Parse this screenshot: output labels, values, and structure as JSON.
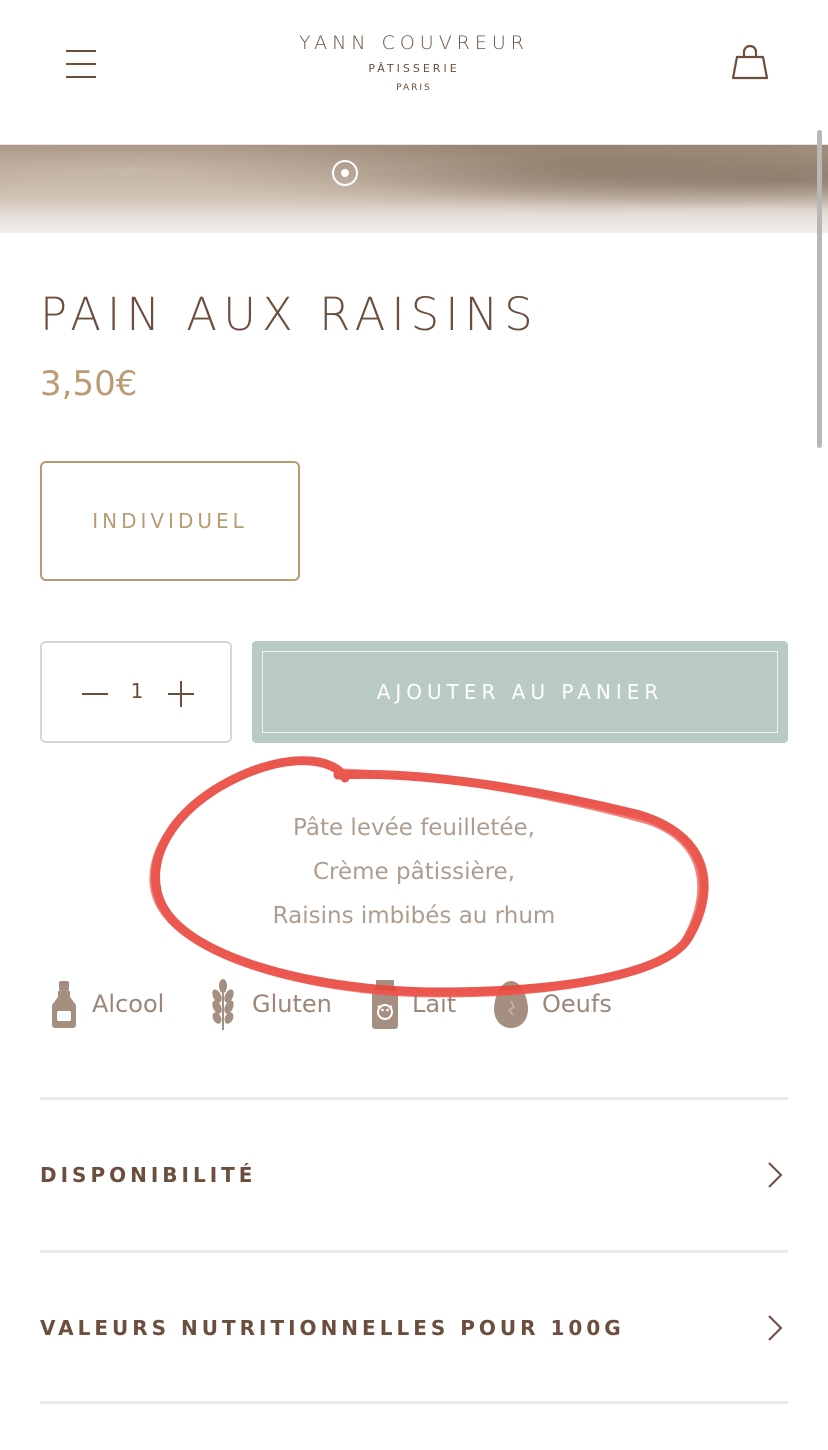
{
  "header": {
    "menu_icon": "hamburger-menu-icon",
    "logo_line1": "YANN COUVREUR",
    "logo_line2": "PÂTISSERIE",
    "logo_line3": "PARIS",
    "cart_icon": "shopping-bag-icon"
  },
  "carousel": {
    "active_dot": 1
  },
  "product": {
    "title": "PAIN AUX RAISINS",
    "price": "3,50€",
    "variant": "INDIVIDUEL",
    "quantity": "1",
    "add_to_cart": "AJOUTER AU PANIER",
    "ingredients": [
      "Pâte levée feuilletée,",
      "Crème pâtissière,",
      "Raisins imbibés au rhum"
    ]
  },
  "allergens": [
    {
      "icon": "bottle-icon",
      "label": "Alcool"
    },
    {
      "icon": "wheat-icon",
      "label": "Gluten"
    },
    {
      "icon": "milk-carton-icon",
      "label": "Lait"
    },
    {
      "icon": "egg-icon",
      "label": "Oeufs"
    }
  ],
  "accordions": [
    {
      "label": "DISPONIBILITÉ"
    },
    {
      "label": "VALEURS NUTRITIONNELLES POUR 100G"
    }
  ],
  "colors": {
    "brown": "#6b4e3d",
    "gold": "#b99b74",
    "sage": "#b9cbc3",
    "annotation_red": "#e8453c"
  }
}
